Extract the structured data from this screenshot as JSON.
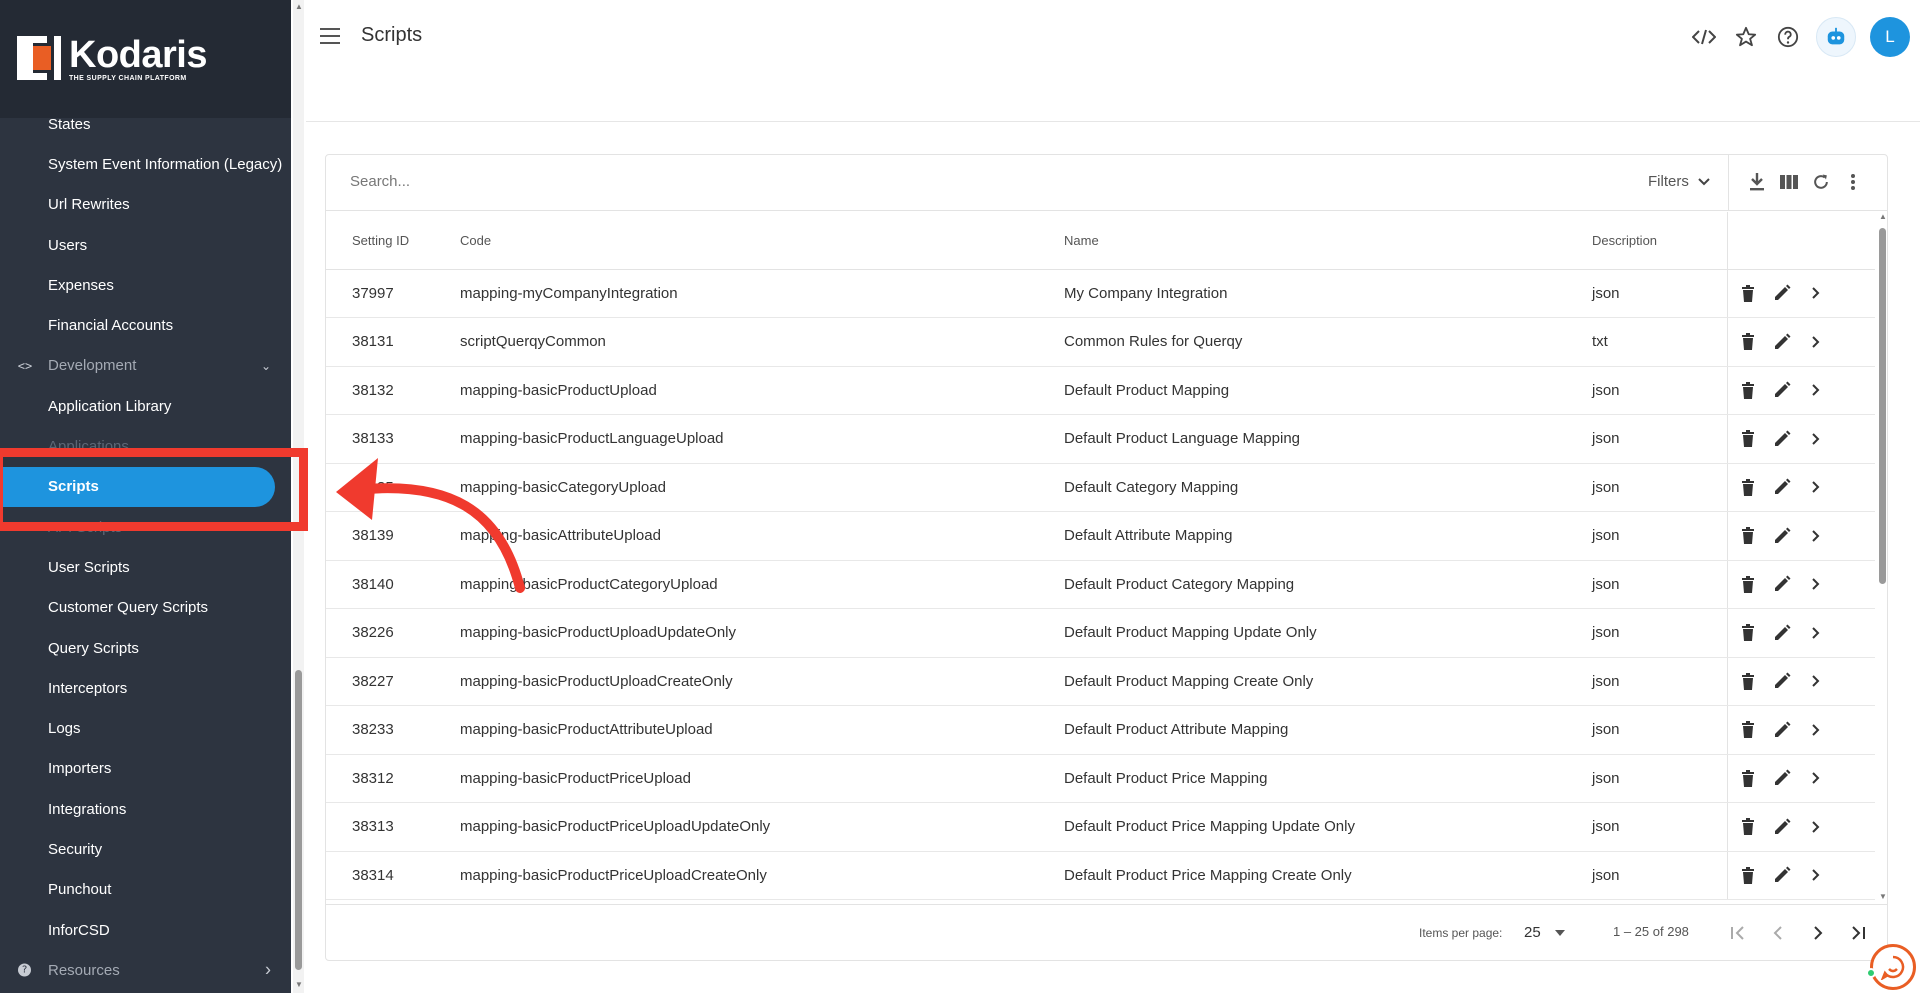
{
  "brand": {
    "name": "Kodaris",
    "tagline": "THE SUPPLY CHAIN PLATFORM",
    "accent": "#1e94de"
  },
  "sidebar": {
    "items": [
      {
        "label": "States",
        "type": "item"
      },
      {
        "label": "System Event Information (Legacy)",
        "type": "item"
      },
      {
        "label": "Url Rewrites",
        "type": "item"
      },
      {
        "label": "Users",
        "type": "item"
      },
      {
        "label": "Expenses",
        "type": "item"
      },
      {
        "label": "Financial Accounts",
        "type": "item"
      },
      {
        "label": "Development",
        "type": "group",
        "icon": "code-icon",
        "expanded": true
      },
      {
        "label": "Application Library",
        "type": "item"
      },
      {
        "label": "Applications",
        "type": "item",
        "obscured": true
      },
      {
        "label": "Scripts",
        "type": "item",
        "active": true
      },
      {
        "label": "API Scripts",
        "type": "item",
        "obscured": true
      },
      {
        "label": "User Scripts",
        "type": "item"
      },
      {
        "label": "Customer Query Scripts",
        "type": "item"
      },
      {
        "label": "Query Scripts",
        "type": "item"
      },
      {
        "label": "Interceptors",
        "type": "item"
      },
      {
        "label": "Logs",
        "type": "item"
      },
      {
        "label": "Importers",
        "type": "item"
      },
      {
        "label": "Integrations",
        "type": "item"
      },
      {
        "label": "Security",
        "type": "item"
      },
      {
        "label": "Punchout",
        "type": "item"
      },
      {
        "label": "InforCSD",
        "type": "item"
      },
      {
        "label": "Resources",
        "type": "group",
        "icon": "help-circle-icon",
        "expanded": false
      }
    ]
  },
  "header": {
    "title": "Scripts",
    "avatar_initial": "L"
  },
  "toolbar": {
    "search_placeholder": "Search...",
    "filters_label": "Filters"
  },
  "table": {
    "columns": [
      "Setting ID",
      "Code",
      "Name",
      "Description"
    ],
    "rows": [
      {
        "id": "37997",
        "code": "mapping-myCompanyIntegration",
        "name": "My Company Integration",
        "desc": "json"
      },
      {
        "id": "38131",
        "code": "scriptQuerqyCommon",
        "name": "Common Rules for Querqy",
        "desc": "txt"
      },
      {
        "id": "38132",
        "code": "mapping-basicProductUpload",
        "name": "Default Product Mapping",
        "desc": "json"
      },
      {
        "id": "38133",
        "code": "mapping-basicProductLanguageUpload",
        "name": "Default Product Language Mapping",
        "desc": "json"
      },
      {
        "id": "38135",
        "code": "mapping-basicCategoryUpload",
        "name": "Default Category Mapping",
        "desc": "json"
      },
      {
        "id": "38139",
        "code": "mapping-basicAttributeUpload",
        "name": "Default Attribute Mapping",
        "desc": "json"
      },
      {
        "id": "38140",
        "code": "mapping-basicProductCategoryUpload",
        "name": "Default Product Category Mapping",
        "desc": "json"
      },
      {
        "id": "38226",
        "code": "mapping-basicProductUploadUpdateOnly",
        "name": "Default Product Mapping Update Only",
        "desc": "json"
      },
      {
        "id": "38227",
        "code": "mapping-basicProductUploadCreateOnly",
        "name": "Default Product Mapping Create Only",
        "desc": "json"
      },
      {
        "id": "38233",
        "code": "mapping-basicProductAttributeUpload",
        "name": "Default Product Attribute Mapping",
        "desc": "json"
      },
      {
        "id": "38312",
        "code": "mapping-basicProductPriceUpload",
        "name": "Default Product Price Mapping",
        "desc": "json"
      },
      {
        "id": "38313",
        "code": "mapping-basicProductPriceUploadUpdateOnly",
        "name": "Default Product Price Mapping Update Only",
        "desc": "json"
      },
      {
        "id": "38314",
        "code": "mapping-basicProductPriceUploadCreateOnly",
        "name": "Default Product Price Mapping Create Only",
        "desc": "json"
      }
    ]
  },
  "paginator": {
    "items_per_page_label": "Items per page:",
    "items_per_page": "25",
    "range_label": "1 – 25 of 298"
  },
  "annotation": {
    "color": "#f03a2e"
  }
}
